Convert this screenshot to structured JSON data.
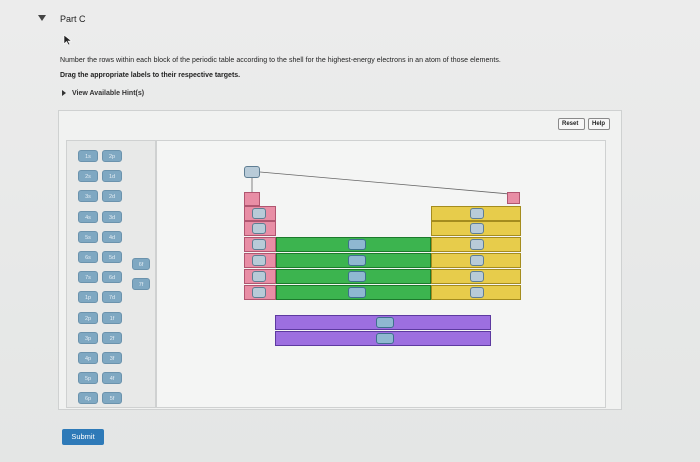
{
  "part": {
    "title": "Part C"
  },
  "instruction": "Number the rows within each block of the periodic table according to the shell for the highest-energy electrons in an atom of those elements.",
  "instruction_bold": "Drag the appropriate labels to their respective targets.",
  "hints": {
    "label": "View Available Hint(s)"
  },
  "toolbar": {
    "reset_label": "Reset",
    "help_label": "Help"
  },
  "labels": {
    "col1": [
      "1s",
      "2s",
      "3s",
      "4s",
      "5s",
      "6s",
      "7s",
      "1p",
      "2p",
      "3p",
      "4p",
      "5p",
      "6p"
    ],
    "col2": [
      "2p",
      "1d",
      "2d",
      "3d",
      "4d",
      "5d",
      "6d",
      "7d",
      "1f",
      "2f",
      "3f",
      "4f",
      "5f"
    ],
    "col3": [
      "6f",
      "7f"
    ]
  },
  "submit": {
    "label": "Submit"
  },
  "colors": {
    "s_block": "#e88ea5",
    "p_block": "#e7cc4b",
    "d_block": "#3cb44f",
    "f_block": "#9d6fe0",
    "label_chip": "#7fa8c2",
    "submit": "#2e7ab8"
  }
}
